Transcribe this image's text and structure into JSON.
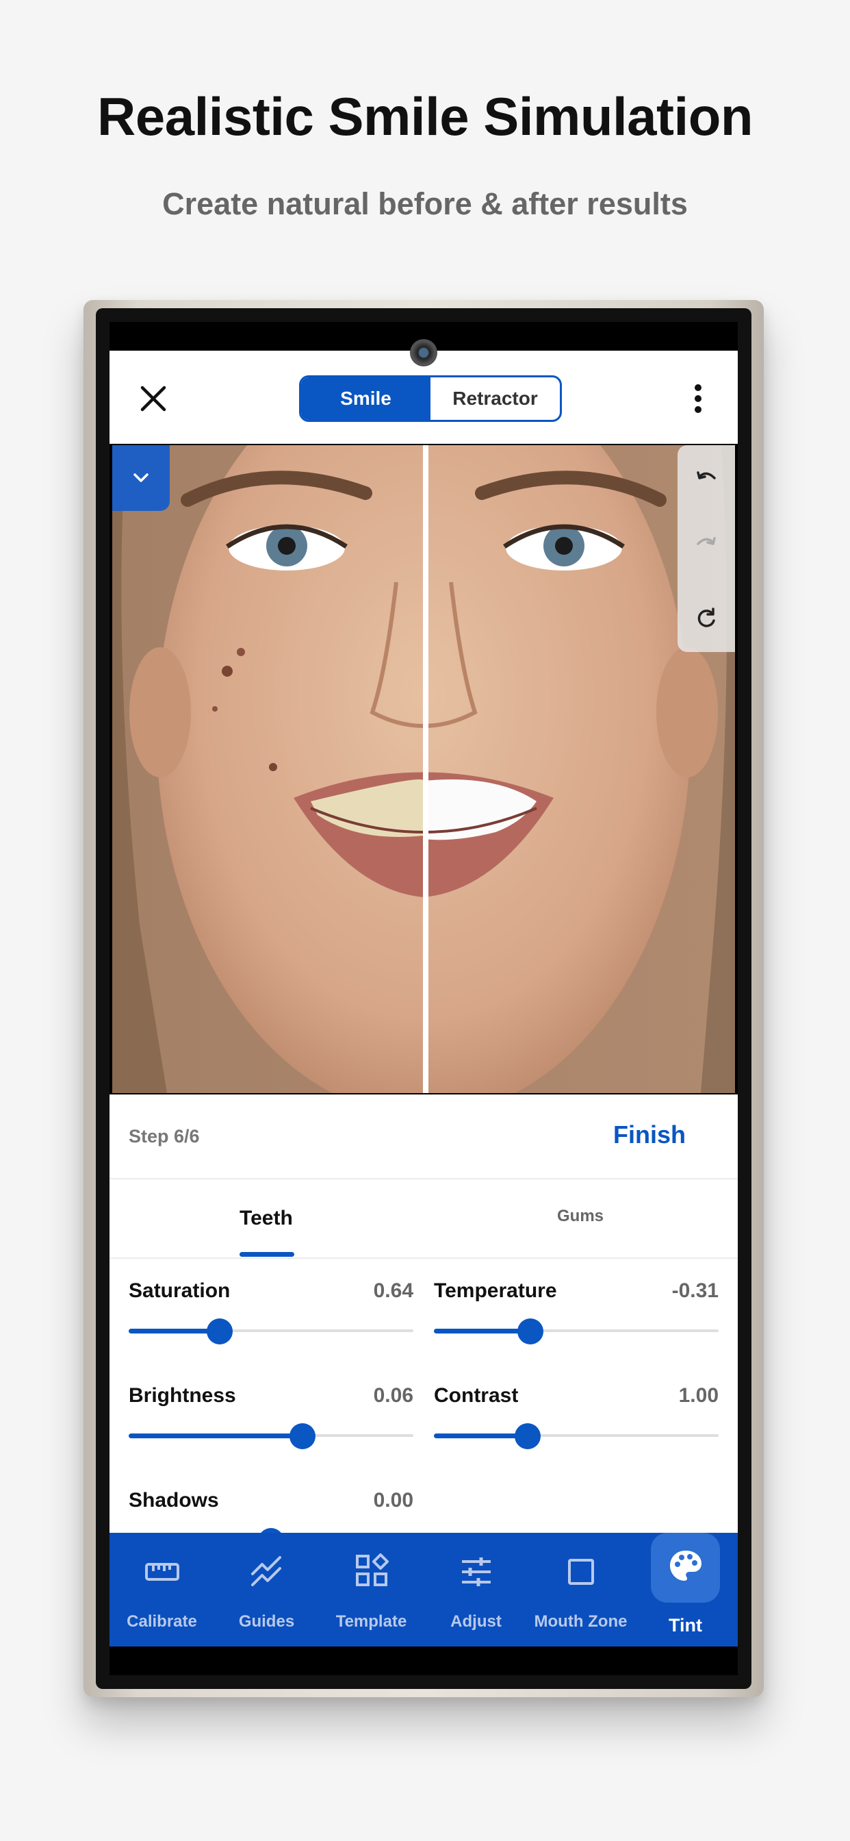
{
  "headline": "Realistic Smile Simulation",
  "subheadline": "Create natural before & after results",
  "appbar": {
    "close_icon": "close-icon",
    "segments": [
      {
        "label": "Smile",
        "active": true
      },
      {
        "label": "Retractor",
        "active": false
      }
    ],
    "more_icon": "more-vert-icon"
  },
  "editor": {
    "collapse_icon": "chevron-down-icon",
    "history": {
      "undo_icon": "undo-icon",
      "redo_icon": "redo-icon",
      "reset_icon": "refresh-icon"
    }
  },
  "step": {
    "label": "Step 6/6",
    "finish_label": "Finish"
  },
  "tabs": [
    {
      "label": "Teeth",
      "active": true
    },
    {
      "label": "Gums",
      "active": false
    }
  ],
  "controls": [
    {
      "name": "Saturation",
      "value": "0.64",
      "fraction": 0.32
    },
    {
      "name": "Temperature",
      "value": "-0.31",
      "fraction": 0.34
    },
    {
      "name": "Brightness",
      "value": "0.06",
      "fraction": 0.61
    },
    {
      "name": "Contrast",
      "value": "1.00",
      "fraction": 0.33
    },
    {
      "name": "Shadows",
      "value": "0.00",
      "fraction": 0.5
    }
  ],
  "nav": [
    {
      "label": "Calibrate",
      "icon": "ruler-icon",
      "active": false
    },
    {
      "label": "Guides",
      "icon": "guides-icon",
      "active": false
    },
    {
      "label": "Template",
      "icon": "template-icon",
      "active": false
    },
    {
      "label": "Adjust",
      "icon": "sliders-icon",
      "active": false
    },
    {
      "label": "Mouth Zone",
      "icon": "square-icon",
      "active": false
    },
    {
      "label": "Tint",
      "icon": "palette-icon",
      "active": true
    }
  ],
  "colors": {
    "accent": "#0a56c2",
    "nav_bg": "#0a4fbd"
  }
}
